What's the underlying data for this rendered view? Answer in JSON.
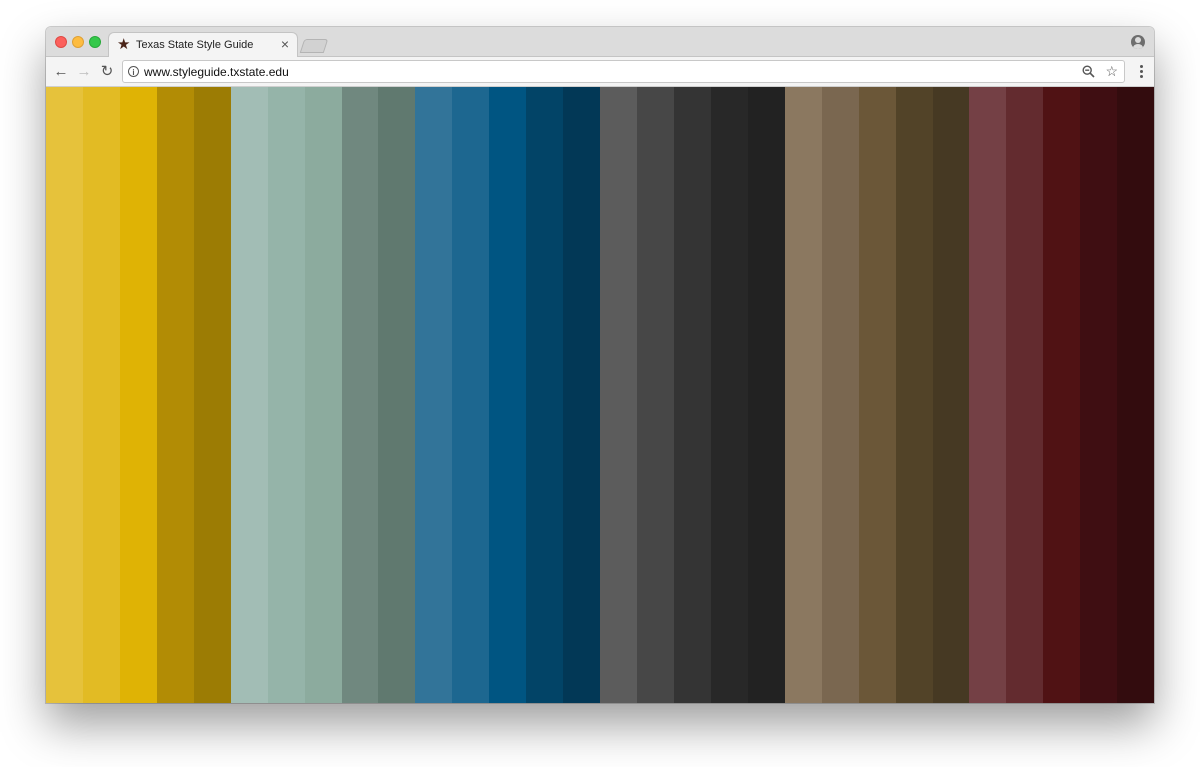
{
  "browser": {
    "tab": {
      "title": "Texas State Style Guide",
      "favicon": "★",
      "close": "×"
    },
    "toolbar": {
      "back": "←",
      "forward": "→",
      "reload": "↻",
      "url": "www.styleguide.txstate.edu",
      "info": "i",
      "bookmark": "☆"
    }
  },
  "palette": {
    "groups": [
      {
        "name": "gold",
        "colors": [
          "#e6c23b",
          "#e2bb24",
          "#dfb305",
          "#b28c05",
          "#9c7c04"
        ]
      },
      {
        "name": "sage",
        "colors": [
          "#a2bdb5",
          "#95b4a9",
          "#8cab9e",
          "#70887f",
          "#60796f"
        ]
      },
      {
        "name": "blue",
        "colors": [
          "#327499",
          "#1d6790",
          "#005582",
          "#024467",
          "#023856"
        ]
      },
      {
        "name": "gray",
        "colors": [
          "#5c5c5c",
          "#474747",
          "#343434",
          "#282828",
          "#222222"
        ]
      },
      {
        "name": "brown",
        "colors": [
          "#8b7860",
          "#7a6750",
          "#6b5738",
          "#524328",
          "#463923"
        ]
      },
      {
        "name": "maroon",
        "colors": [
          "#744045",
          "#632b2f",
          "#501214",
          "#3f0e12",
          "#330c0e"
        ]
      }
    ]
  }
}
